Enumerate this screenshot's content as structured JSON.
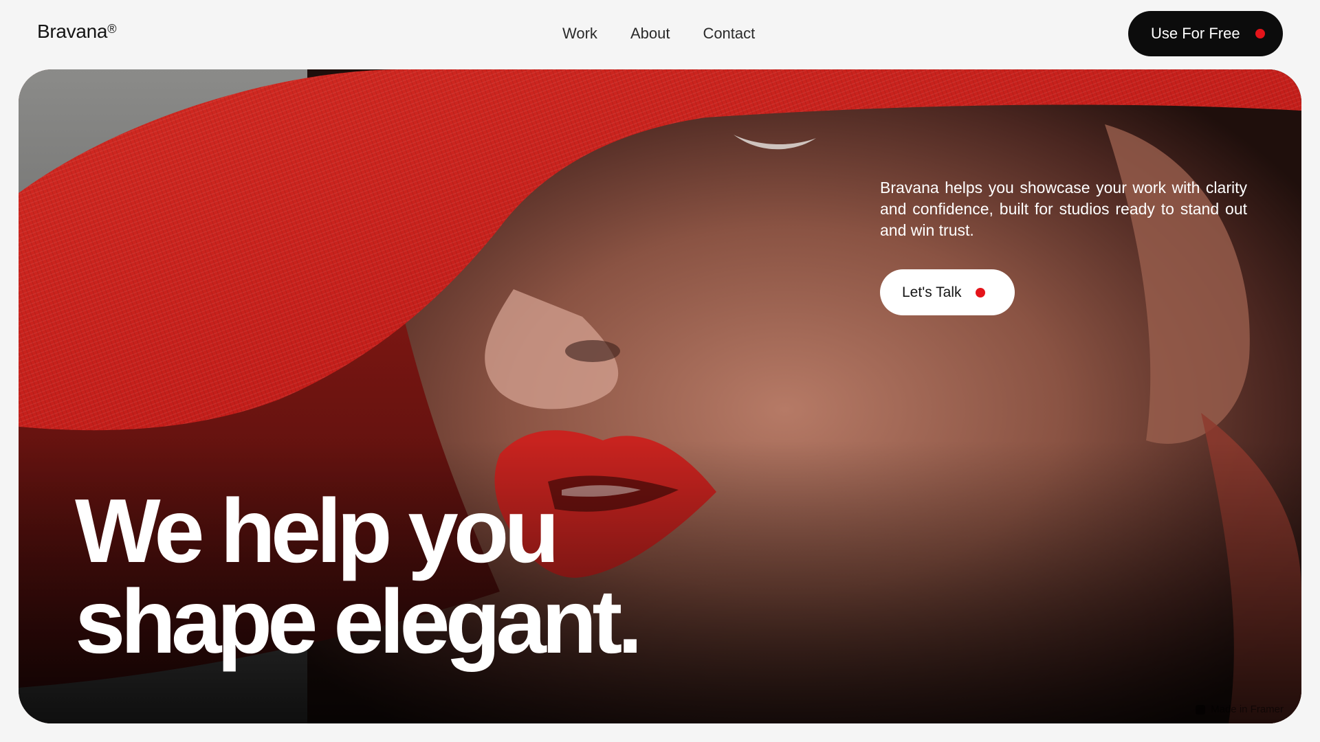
{
  "header": {
    "logo": "Bravana",
    "logo_mark": "®",
    "nav": [
      {
        "label": "Work"
      },
      {
        "label": "About"
      },
      {
        "label": "Contact"
      }
    ],
    "cta_label": "Use For Free"
  },
  "hero": {
    "description": "Bravana helps you showcase your work with clarity and confidence, built for studios ready to stand out and win trust.",
    "cta_label": "Let's Talk",
    "headline_line1": "We help you",
    "headline_line2": "shape elegant."
  },
  "badge": {
    "label": "Made in Framer",
    "icon": "framer-icon"
  },
  "colors": {
    "accent": "#e4141a",
    "dark": "#0c0c0c",
    "page_bg": "#f5f5f5"
  }
}
